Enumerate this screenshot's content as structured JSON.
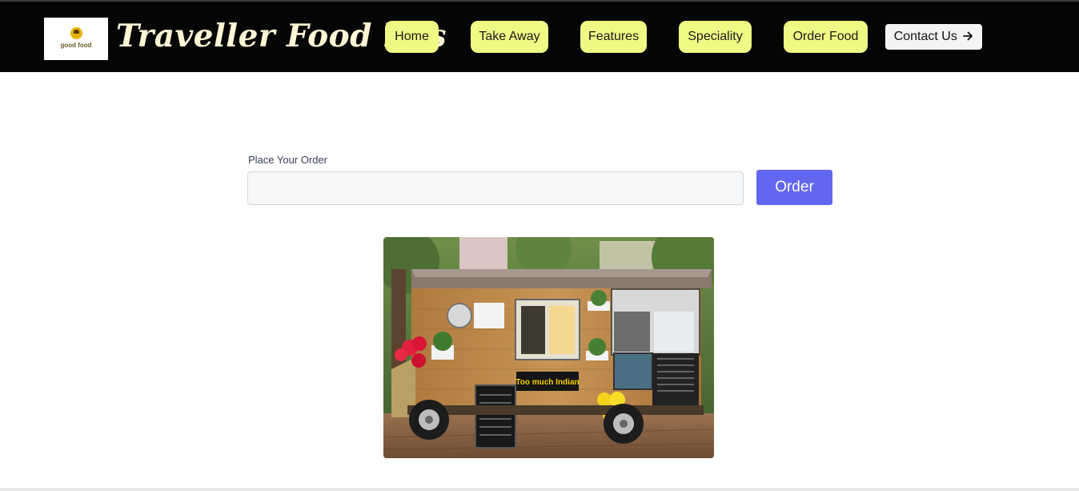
{
  "header": {
    "logo": {
      "text": "good food"
    },
    "brand_title": "Traveller Food bus",
    "nav": [
      {
        "label": "Home"
      },
      {
        "label": "Take Away"
      },
      {
        "label": "Features"
      },
      {
        "label": "Speciality"
      },
      {
        "label": "Order Food"
      }
    ],
    "contact_button": {
      "label": "Contact Us",
      "icon": "arrow-right-icon"
    }
  },
  "order_form": {
    "label": "Place Your Order",
    "input_value": "",
    "button_label": "Order",
    "button_color": "#6366f1"
  },
  "food_truck_image": {
    "truck_sign": "Too much Indian",
    "content": "food-truck-photo"
  },
  "colors": {
    "header_bg": "#050505",
    "nav_button_bg": "#f1f985",
    "brand_text": "#fff7d6"
  }
}
